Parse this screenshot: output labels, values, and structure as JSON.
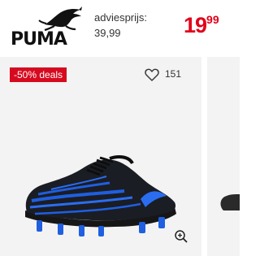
{
  "header": {
    "brand": "PUMA",
    "brand_icon": "puma-cat-logo",
    "advies_label": "adviesprijs:",
    "advies_price": "39,99",
    "price_main": "19",
    "price_cents": "99"
  },
  "product": {
    "deal_badge": "-50% deals",
    "favorite_count": "151",
    "favorite_icon": "heart-outline",
    "zoom_icon": "zoom-in",
    "image_name": "puma football boot black blue"
  },
  "colors": {
    "price_red": "#e2001a",
    "badge_red": "#d60a1f",
    "card_bg": "#f3f3f3",
    "shoe_blue": "#1f5fe0"
  }
}
